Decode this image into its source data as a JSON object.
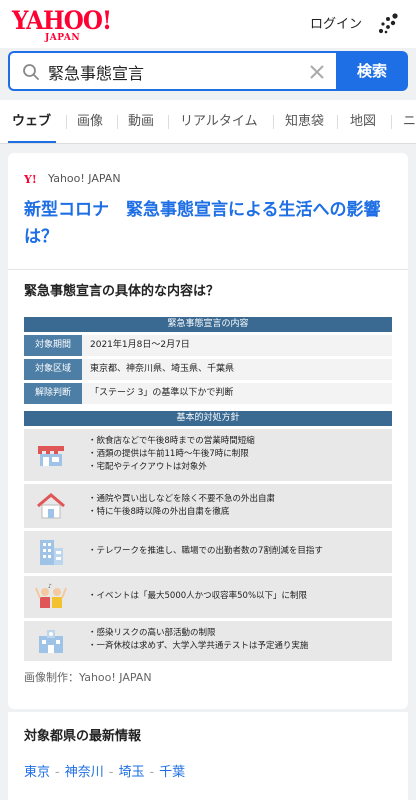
{
  "header": {
    "logo_main": "YAHOO!",
    "logo_sub": "JAPAN",
    "login_label": "ログイン",
    "menu_icon": "apps-dots-icon"
  },
  "search": {
    "query": "緊急事態宣言",
    "button_label": "検索"
  },
  "tabs": [
    {
      "label": "ウェブ",
      "active": true
    },
    {
      "label": "画像"
    },
    {
      "label": "動画"
    },
    {
      "label": "リアルタイム"
    },
    {
      "label": "知恵袋"
    },
    {
      "label": "地図"
    },
    {
      "label": "ニ"
    }
  ],
  "result": {
    "source": "Yahoo! JAPAN",
    "title": "新型コロナ　緊急事態宣言による生活への影響は？",
    "section_heading": "緊急事態宣言の具体的な内容は？",
    "credit": "画像制作：Yahoo! JAPAN"
  },
  "infographic": {
    "header1": "緊急事態宣言の内容",
    "rows": [
      {
        "label": "対象期間",
        "value": "2021年1月8日～2月7日"
      },
      {
        "label": "対象区域",
        "value": "東京都、神奈川県、埼玉県、千葉県"
      },
      {
        "label": "解除判断",
        "value": "「ステージ 3」の基準以下かで判断"
      }
    ],
    "header2": "基本的対処方針",
    "policies": [
      {
        "icon": "restaurant-icon",
        "lines": [
          "・飲食店などで午後8時までの営業時間短縮",
          "・酒類の提供は午前11時～午後7時に制限",
          "・宅配やテイクアウトは対象外"
        ]
      },
      {
        "icon": "house-icon",
        "lines": [
          "・通院や買い出しなどを除く不要不急の外出自粛",
          "・特に午後8時以降の外出自粛を徹底"
        ]
      },
      {
        "icon": "office-building-icon",
        "lines": [
          "・テレワークを推進し、職場での出勤者数の7割削減を目指す"
        ]
      },
      {
        "icon": "event-people-icon",
        "lines": [
          "・イベントは「最大5000人かつ収容率50%以下」に制限"
        ]
      },
      {
        "icon": "school-icon",
        "lines": [
          "・感染リスクの高い部活動の制限",
          "・一斉休校は求めず、大学入学共通テストは予定通り実施"
        ]
      }
    ]
  },
  "prefectures": {
    "heading": "対象都県の最新情報",
    "links": [
      "東京",
      "神奈川",
      "埼玉",
      "千葉"
    ],
    "separator": "-"
  }
}
